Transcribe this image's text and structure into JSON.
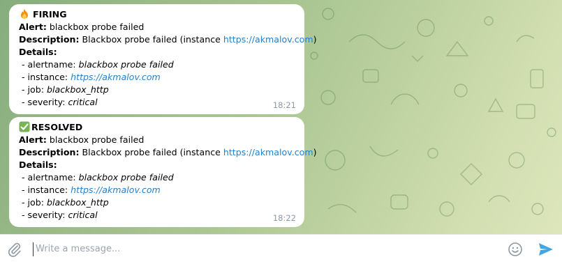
{
  "messages": [
    {
      "status_icon": "fire-emoji",
      "status": "FIRING",
      "alert_label": "Alert:",
      "alert_value": "blackbox probe failed",
      "desc_label": "Description:",
      "desc_text": "Blackbox probe failed (instance ",
      "desc_link": "https://akmalov.com",
      "desc_close": ")",
      "details_label": "Details:",
      "d1_label": " - alertname: ",
      "d1_value": "blackbox probe failed",
      "d2_label": " - instance: ",
      "d2_value": "https://akmalov.com",
      "d3_label": " - job: ",
      "d3_value": "blackbox_http",
      "d4_label": " - severity: ",
      "d4_value": "critical",
      "time": "18:21"
    },
    {
      "status_icon": "check-mark-emoji",
      "status": "RESOLVED",
      "alert_label": "Alert:",
      "alert_value": "blackbox probe failed",
      "desc_label": "Description:",
      "desc_text": "Blackbox probe failed (instance ",
      "desc_link": "https://akmalov.com",
      "desc_close": ")",
      "details_label": "Details:",
      "d1_label": " - alertname: ",
      "d1_value": "blackbox probe failed",
      "d2_label": " - instance: ",
      "d2_value": "https://akmalov.com",
      "d3_label": " - job: ",
      "d3_value": "blackbox_http",
      "d4_label": " - severity: ",
      "d4_value": "critical",
      "time": "18:22"
    }
  ],
  "composer": {
    "placeholder": "Write a message...",
    "attach_icon": "paperclip-icon",
    "emoji_icon": "smiley-icon",
    "send_icon": "send-icon"
  },
  "colors": {
    "link": "#2481cc",
    "send": "#40a7e3",
    "timestamp": "#8a9aa8"
  }
}
